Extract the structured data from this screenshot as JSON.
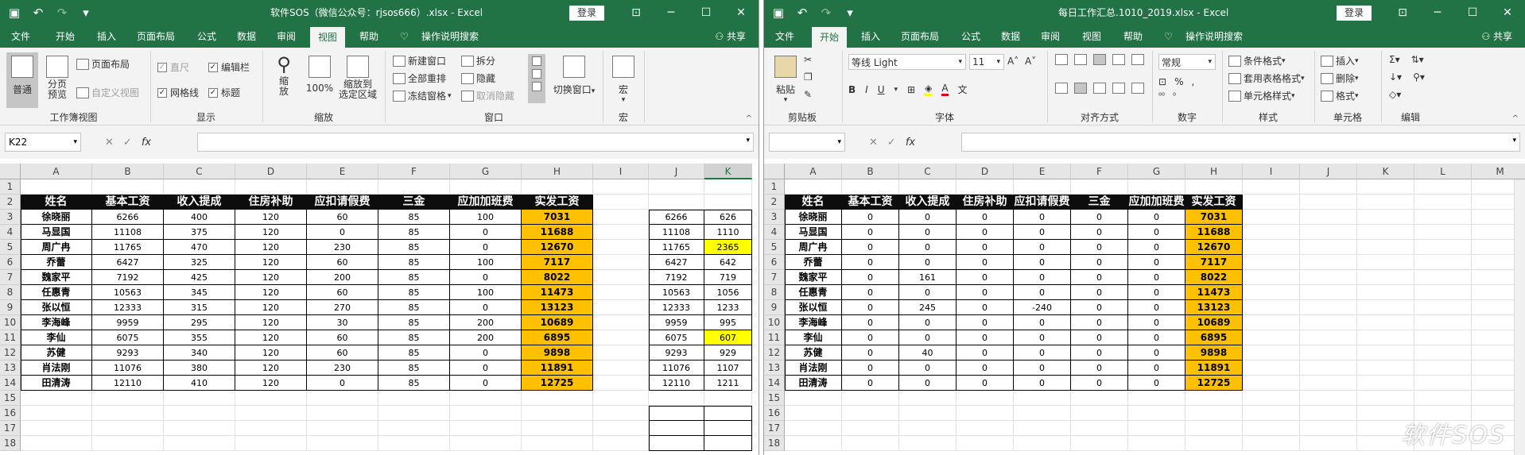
{
  "qa_icons": [
    "save-icon",
    "undo-icon",
    "redo-icon",
    "customize-icon"
  ],
  "login": "登录",
  "window_buttons": [
    "⊡",
    "─",
    "☐",
    "✕"
  ],
  "share": "共享",
  "collapse": "^",
  "fx_buttons": [
    "✕",
    "✓",
    "fx"
  ],
  "colors": {
    "brand": "#217346",
    "header_bg": "#0d0d0d",
    "pay_bg": "#ffc000",
    "highlight": "#ffff00"
  },
  "win1": {
    "title": "软件SOS（微信公众号：rjsos666）.xlsx  -  Excel",
    "tabs": [
      "文件",
      "开始",
      "插入",
      "页面布局",
      "公式",
      "数据",
      "审阅",
      "视图",
      "帮助",
      "操作说明搜索"
    ],
    "active_tab": "视图",
    "ribbon": {
      "normal": "普通",
      "page_break": "分页\n预览",
      "page_layout": "页面布局",
      "custom_view": "自定义视图",
      "ruler": "直尺",
      "formula_bar": "编辑栏",
      "gridlines": "网格线",
      "headings": "标题",
      "zoom": "缩\n放",
      "zoom100": "100%",
      "zoom_sel": "缩放到\n选定区域",
      "new_window": "新建窗口",
      "arrange_all": "全部重排",
      "freeze": "冻结窗格",
      "split": "拆分",
      "hide": "隐藏",
      "unhide": "取消隐藏",
      "switch": "切换窗口",
      "macro": "宏",
      "groups": [
        "工作簿视图",
        "显示",
        "缩放",
        "窗口",
        "宏"
      ]
    },
    "namebox": "K22",
    "columns": [
      "A",
      "B",
      "C",
      "D",
      "E",
      "F",
      "G",
      "H",
      "I",
      "J",
      "K"
    ],
    "rows": [
      "1",
      "2",
      "3",
      "4",
      "5",
      "6",
      "7",
      "8",
      "9",
      "10",
      "11",
      "12",
      "13",
      "14",
      "15",
      "16",
      "17",
      "18"
    ],
    "headers": [
      "姓名",
      "基本工资",
      "收入提成",
      "住房补助",
      "应扣请假费",
      "三金",
      "应加加班费",
      "实发工资"
    ],
    "table": [
      [
        "徐晓丽",
        "6266",
        "400",
        "120",
        "60",
        "85",
        "100",
        "7031"
      ],
      [
        "马显国",
        "11108",
        "375",
        "120",
        "0",
        "85",
        "0",
        "11688"
      ],
      [
        "周广冉",
        "11765",
        "470",
        "120",
        "230",
        "85",
        "0",
        "12670"
      ],
      [
        "乔蕾",
        "6427",
        "325",
        "120",
        "60",
        "85",
        "100",
        "7117"
      ],
      [
        "魏家平",
        "7192",
        "425",
        "120",
        "200",
        "85",
        "0",
        "8022"
      ],
      [
        "任惠青",
        "10563",
        "345",
        "120",
        "60",
        "85",
        "100",
        "11473"
      ],
      [
        "张以恒",
        "12333",
        "315",
        "120",
        "270",
        "85",
        "0",
        "13123"
      ],
      [
        "李海峰",
        "9959",
        "295",
        "120",
        "30",
        "85",
        "200",
        "10689"
      ],
      [
        "李仙",
        "6075",
        "355",
        "120",
        "60",
        "85",
        "200",
        "6895"
      ],
      [
        "苏健",
        "9293",
        "340",
        "120",
        "60",
        "85",
        "0",
        "9898"
      ],
      [
        "肖法刚",
        "11076",
        "380",
        "120",
        "230",
        "85",
        "0",
        "11891"
      ],
      [
        "田清涛",
        "12110",
        "410",
        "120",
        "0",
        "85",
        "0",
        "12725"
      ]
    ],
    "j_values": [
      "6266",
      "11108",
      "11765",
      "6427",
      "7192",
      "10563",
      "12333",
      "9959",
      "6075",
      "9293",
      "11076",
      "12110"
    ],
    "k_values": [
      "626",
      "1110",
      "2365",
      "642",
      "719",
      "1056",
      "1233",
      "995",
      "607",
      "929",
      "1107",
      "1211"
    ]
  },
  "win2": {
    "title": "每日工作汇总.1010_2019.xlsx  -  Excel",
    "tabs": [
      "文件",
      "开始",
      "插入",
      "页面布局",
      "公式",
      "数据",
      "审阅",
      "视图",
      "帮助",
      "操作说明搜索"
    ],
    "active_tab": "开始",
    "ribbon": {
      "paste": "粘贴",
      "font_name": "等线 Light",
      "font_size": "11",
      "number_format": "常规",
      "cond_format": "条件格式",
      "table_format": "套用表格格式",
      "cell_style": "单元格样式",
      "insert": "插入",
      "delete": "删除",
      "format": "格式",
      "groups": [
        "剪贴板",
        "字体",
        "对齐方式",
        "数字",
        "样式",
        "单元格",
        "编辑"
      ]
    },
    "namebox": "",
    "columns": [
      "A",
      "B",
      "C",
      "D",
      "E",
      "F",
      "G",
      "H",
      "I",
      "J",
      "K",
      "L",
      "M"
    ],
    "rows": [
      "1",
      "2",
      "3",
      "4",
      "5",
      "6",
      "7",
      "8",
      "9",
      "10",
      "11",
      "12",
      "13",
      "14",
      "15",
      "16",
      "17",
      "18"
    ],
    "headers": [
      "姓名",
      "基本工资",
      "收入提成",
      "住房补助",
      "应扣请假费",
      "三金",
      "应加加班费",
      "实发工资"
    ],
    "table": [
      [
        "徐晓丽",
        "0",
        "0",
        "0",
        "0",
        "0",
        "0",
        "7031"
      ],
      [
        "马显国",
        "0",
        "0",
        "0",
        "0",
        "0",
        "0",
        "11688"
      ],
      [
        "周广冉",
        "0",
        "0",
        "0",
        "0",
        "0",
        "0",
        "12670"
      ],
      [
        "乔蕾",
        "0",
        "0",
        "0",
        "0",
        "0",
        "0",
        "7117"
      ],
      [
        "魏家平",
        "0",
        "161",
        "0",
        "0",
        "0",
        "0",
        "8022"
      ],
      [
        "任惠青",
        "0",
        "0",
        "0",
        "0",
        "0",
        "0",
        "11473"
      ],
      [
        "张以恒",
        "0",
        "245",
        "0",
        "-240",
        "0",
        "0",
        "13123"
      ],
      [
        "李海峰",
        "0",
        "0",
        "0",
        "0",
        "0",
        "0",
        "10689"
      ],
      [
        "李仙",
        "0",
        "0",
        "0",
        "0",
        "0",
        "0",
        "6895"
      ],
      [
        "苏健",
        "0",
        "40",
        "0",
        "0",
        "0",
        "0",
        "9898"
      ],
      [
        "肖法刚",
        "0",
        "0",
        "0",
        "0",
        "0",
        "0",
        "11891"
      ],
      [
        "田清涛",
        "0",
        "0",
        "0",
        "0",
        "0",
        "0",
        "12725"
      ]
    ]
  },
  "watermark": "软件SOS"
}
